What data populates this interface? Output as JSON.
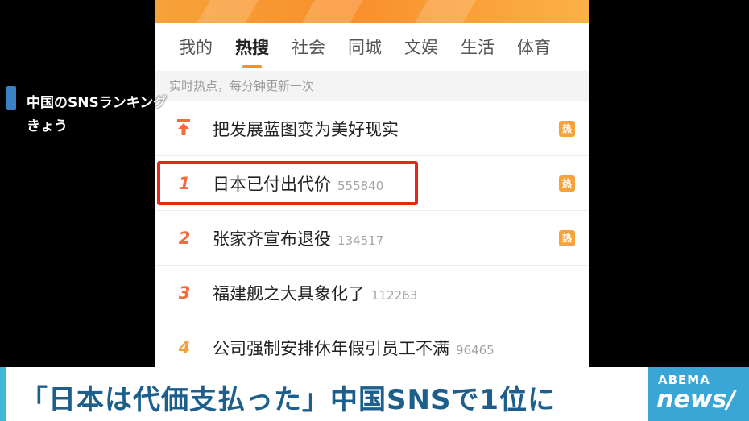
{
  "phone": {
    "tabs": [
      "我的",
      "热搜",
      "社会",
      "同城",
      "文娱",
      "生活",
      "体育"
    ],
    "hint": "实时热点，每分钟更新一次",
    "hot_label": "热",
    "rows": [
      {
        "rank": "",
        "title": "把发展蓝图变为美好现实",
        "count": "",
        "hot": true,
        "pinned": true
      },
      {
        "rank": "1",
        "title": "日本已付出代价",
        "count": "555840",
        "hot": true,
        "pinned": false
      },
      {
        "rank": "2",
        "title": "张家齐宣布退役",
        "count": "134517",
        "hot": true,
        "pinned": false
      },
      {
        "rank": "3",
        "title": "福建舰之大具象化了",
        "count": "112263",
        "hot": false,
        "pinned": false
      },
      {
        "rank": "4",
        "title": "公司强制安排休年假引员工不满",
        "count": "96465",
        "hot": false,
        "pinned": false
      }
    ]
  },
  "overlay": {
    "line1": "中国のSNSランキング",
    "line2": "きょう"
  },
  "caption": "「日本は代価支払った」中国SNSで1位に",
  "logo": {
    "top": "ABEMA",
    "bottom": "news/"
  },
  "colors": {
    "accent_orange": "#f98f2b",
    "highlight_red": "#e8261c",
    "caption_blue": "#1d5f8c"
  }
}
